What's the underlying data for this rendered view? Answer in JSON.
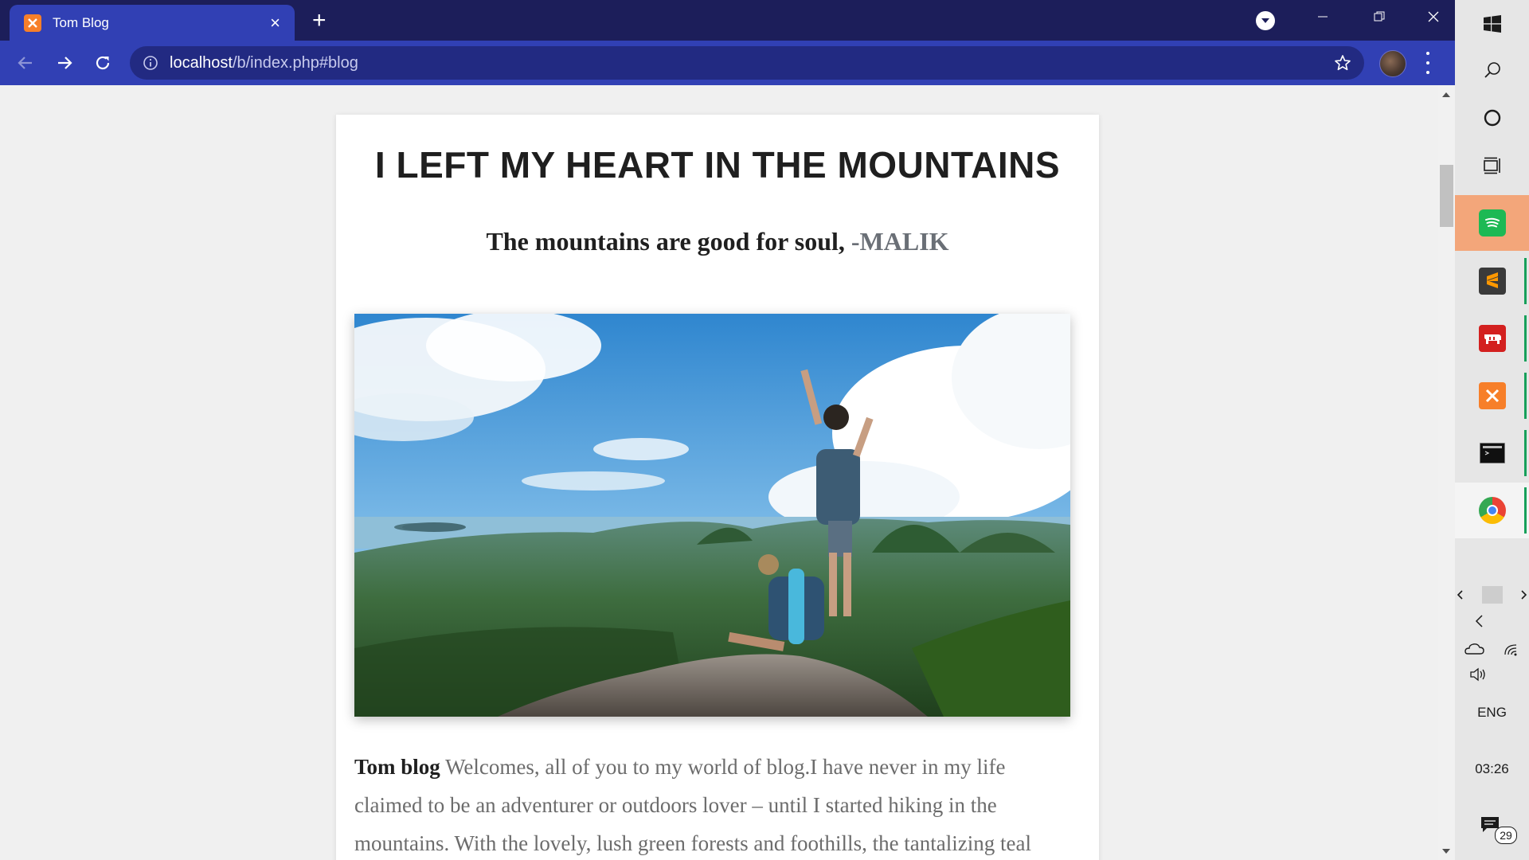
{
  "browser": {
    "tab": {
      "title": "Tom Blog",
      "favicon": "xampp-icon",
      "close": "×"
    },
    "new_tab": "+",
    "url": {
      "host": "localhost",
      "path": "/b/index.php#blog"
    },
    "accent": "#3140b4",
    "frame": "#1c1e5a"
  },
  "post": {
    "title": "I LEFT MY HEART IN THE MOUNTAINS",
    "subtitle_lead": "The mountains are good for soul,",
    "subtitle_author": "-MALIK",
    "body_brand": "Tom blog",
    "body_text": "Welcomes, all of you to my world of blog.I have never in my life claimed to be an adventurer or outdoors lover – until I started hiking in the mountains. With the lovely, lush green forests and foothills, the tantalizing teal lakes hidden away like a secret prize waiting to be found, and those stunning"
  },
  "taskbar": {
    "apps": [
      {
        "name": "spotify-icon",
        "color": "#1db954"
      },
      {
        "name": "sublime-text-icon",
        "color": "#ff9800"
      },
      {
        "name": "mamp-icon",
        "color": "#d3201f"
      },
      {
        "name": "xampp-icon",
        "color": "#f77f29"
      },
      {
        "name": "terminal-icon",
        "color": "#101010"
      },
      {
        "name": "chrome-icon",
        "color": "#4285f4"
      }
    ],
    "language": "ENG",
    "time": "03:26",
    "notifications": "29"
  }
}
